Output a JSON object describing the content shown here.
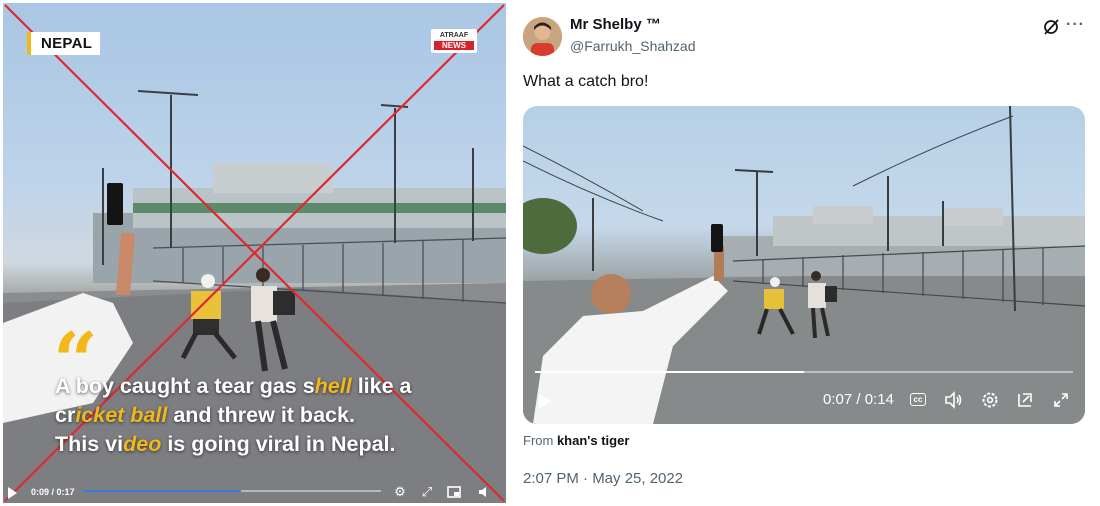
{
  "left_video": {
    "location_tag": "NEPAL",
    "logo_top": "ATRAAF",
    "logo_bottom": "NEWS",
    "quote_glyph": "“",
    "caption_lines": [
      [
        {
          "t": "A boy caught a tear gas s",
          "hl": false
        },
        {
          "t": "hell",
          "hl": true
        },
        {
          "t": " like a",
          "hl": false
        }
      ],
      [
        {
          "t": "cr",
          "hl": false
        },
        {
          "t": "icket ball",
          "hl": true
        },
        {
          "t": " and threw it back.",
          "hl": false
        }
      ],
      [
        {
          "t": "This vi",
          "hl": false
        },
        {
          "t": "deo",
          "hl": true
        },
        {
          "t": " is going viral in Nepal.",
          "hl": false
        }
      ]
    ],
    "time": "0:09 / 0:17",
    "progress": 0.53,
    "cross_color": "#e0282e",
    "accent": "#f2b71a"
  },
  "tweet": {
    "display_name": "Mr Shelby ™",
    "handle": "@Farrukh_Shahzad",
    "text": "What a catch bro!",
    "video_time": "0:07 / 0:14",
    "video_progress": 0.5,
    "from_prefix": "From ",
    "from_source": "khan's tiger",
    "timestamp": "2:07 PM · May 25, 2022",
    "more_glyph": "···"
  },
  "icons": {
    "left": [
      "play-icon",
      "settings-icon",
      "fullscreen-icon",
      "pip-icon",
      "volume-icon"
    ],
    "tweet": [
      "grok-icon",
      "more-icon",
      "play-icon",
      "captions-icon",
      "volume-icon",
      "settings-icon",
      "pop-out-icon",
      "expand-icon"
    ]
  }
}
